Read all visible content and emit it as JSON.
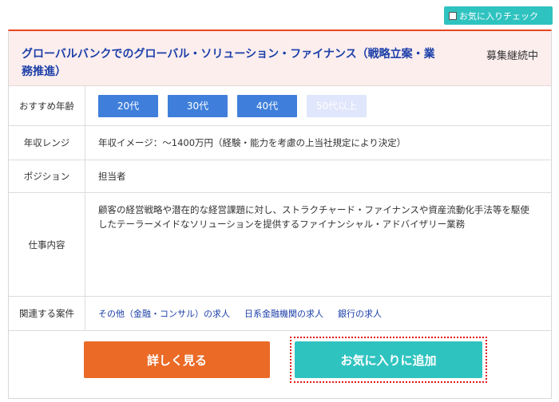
{
  "top_button": {
    "label": "お気に入りチェック"
  },
  "job": {
    "title": "グローバルバンクでのグローバル・ソリューション・ファイナンス（戦略立案・業務推進）",
    "status": "募集継続中"
  },
  "rows": {
    "age": {
      "label": "おすすめ年齢",
      "options": [
        "20代",
        "30代",
        "40代",
        "50代以上"
      ]
    },
    "income": {
      "label": "年収レンジ",
      "value": "年収イメージ：～1400万円（経験・能力を考慮の上当社規定により決定）"
    },
    "position": {
      "label": "ポジション",
      "value": "担当者"
    },
    "work": {
      "label": "仕事内容",
      "value": "顧客の経営戦略や潜在的な経営課題に対し、ストラクチャード・ファイナンスや資産流動化手法等を駆使したテーラーメイドなソリューションを提供するファイナンシャル・アドバイザリー業務"
    },
    "related": {
      "label": "関連する案件",
      "links": [
        "その他（金融・コンサル）の求人",
        "日系金融機関の求人",
        "銀行の求人"
      ]
    }
  },
  "actions": {
    "detail_label": "詳しく見る",
    "favorite_label": "お気に入りに追加"
  },
  "colors": {
    "accent_teal": "#2fc3c0",
    "accent_orange": "#ea6a26",
    "header_border": "#e8461e",
    "age_active": "#3f7fdb",
    "link": "#1b3fa8"
  }
}
